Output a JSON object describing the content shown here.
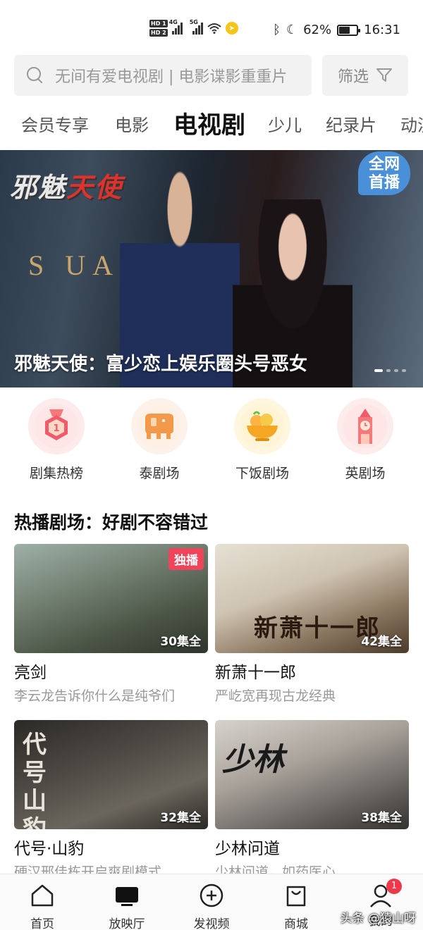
{
  "status_bar": {
    "hd1": "HD 1",
    "hd2": "HD 2",
    "net1": "4G",
    "net2": "5G",
    "battery_percent": "62%",
    "battery_level": 0.62,
    "time": "16:31"
  },
  "search": {
    "placeholder": "无间有爱电视剧 | 电影谍影重重片",
    "filter_label": "筛选"
  },
  "tabs": [
    {
      "label": "会员专享"
    },
    {
      "label": "电影"
    },
    {
      "label": "电视剧"
    },
    {
      "label": "少儿"
    },
    {
      "label": "纪录片"
    },
    {
      "label": "动漫"
    }
  ],
  "active_tab": "电视剧",
  "banner": {
    "logo_part1": "邪魅",
    "logo_part2": "天使",
    "sign_text": "S UARE",
    "badge_line1": "全网",
    "badge_line2": "首播",
    "caption": "邪魅天使：富少恋上娱乐圈头号恶女",
    "slides": 4,
    "current_slide": 1
  },
  "categories": [
    {
      "label": "剧集热榜",
      "icon": "medal-icon"
    },
    {
      "label": "泰剧场",
      "icon": "elephant-icon"
    },
    {
      "label": "下饭剧场",
      "icon": "food-bowl-icon"
    },
    {
      "label": "英剧场",
      "icon": "big-ben-icon"
    }
  ],
  "section": {
    "title": "热播剧场：好剧不容错过"
  },
  "cards": [
    {
      "title": "亮剑",
      "subtitle": "李云龙告诉你什么是纯爷们",
      "episodes": "30集全",
      "tag": "独播"
    },
    {
      "title": "新萧十一郎",
      "subtitle": "严屹宽再现古龙经典",
      "episodes": "42集全",
      "poster_text": "新萧十一郎"
    },
    {
      "title": "代号·山豹",
      "subtitle": "硬汉邢佳栋开启爽剧模式",
      "episodes": "32集全",
      "poster_text": "代号山豹"
    },
    {
      "title": "少林问道",
      "subtitle": "少林问道，如药医心",
      "episodes": "38集全",
      "poster_text": "少林"
    }
  ],
  "bottom_nav": [
    {
      "label": "首页",
      "icon": "home-icon"
    },
    {
      "label": "放映厅",
      "icon": "tv-icon"
    },
    {
      "label": "发视频",
      "icon": "plus-circle-icon"
    },
    {
      "label": "商城",
      "icon": "shopping-bag-icon"
    },
    {
      "label": "我的",
      "icon": "user-icon",
      "badge": "1"
    }
  ],
  "watermark": "头条 @猿山呀",
  "colors": {
    "accent_red": "#f0445a",
    "premiere_blue": "#4a90d9"
  }
}
